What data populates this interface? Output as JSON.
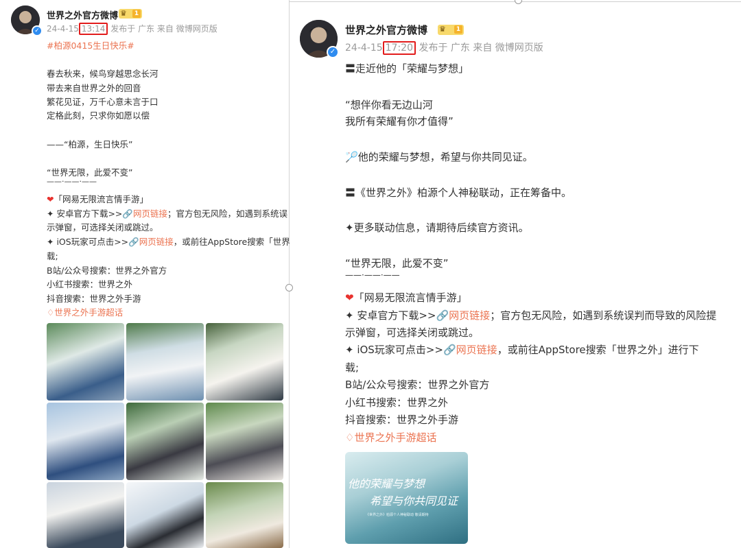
{
  "left_post": {
    "author": "世界之外官方微博",
    "level": "1",
    "date": "24-4-15",
    "time": "13:14",
    "source": "发布于 广东 来自 微博网页版",
    "hashtag": "#柏源0415生日快乐#",
    "poem": [
      "春去秋来，候鸟穿越思念长河",
      "带去来自世界之外的回音",
      "繁花见证，万千心意未言于口",
      "定格此刻，只求你如愿以偿"
    ],
    "wish": "——“柏源，生日快乐”",
    "motto": "“世界无限，此爱不变”",
    "separator": "——·——·——",
    "game_title": "「网易无限流言情手游」",
    "android_prefix": "✦ 安卓官方下载>>",
    "link_text": "网页链接",
    "android_suffix": "；官方包无风险，如遇到系统误",
    "android_cont": "示弹窗，可选择关闭或跳过。",
    "ios_prefix": "✦ iOS玩家可点击>>",
    "ios_suffix": "，或前往AppStore搜索「世界",
    "ios_cont": "载;",
    "bilibili": "B站/公众号搜索：世界之外官方",
    "xiaohongshu": "小红书搜索：世界之外",
    "douyin": "抖音搜索：世界之外手游",
    "super_topic": "世界之外手游超话"
  },
  "right_post": {
    "author": "世界之外官方微博",
    "level": "1",
    "date": "24-4-15",
    "time": "17:20",
    "source": "发布于 广东 来自 微博网页版",
    "intro": "〓走近他的「荣耀与梦想」",
    "quote_1": "“想伴你看无边山河",
    "quote_2": "我所有荣耀有你才值得”",
    "witness": "他的荣耀与梦想，希望与你共同见证。",
    "collab": "〓《世界之外》柏源个人神秘联动，正在筹备中。",
    "more_info": "✦更多联动信息，请期待后续官方资讯。",
    "motto": "“世界无限，此爱不变”",
    "separator": "——·——·——",
    "game_title": "「网易无限流言情手游」",
    "android_prefix": "✦ 安卓官方下载>>",
    "link_text": "网页链接",
    "android_suffix": "；官方包无风险，如遇到系统误判而导致的风险提",
    "android_cont": "示弹窗，可选择关闭或跳过。",
    "ios_prefix": "✦ iOS玩家可点击>>",
    "ios_suffix": "，或前往AppStore搜索「世界之外」进行下",
    "ios_cont": "载;",
    "bilibili": "B站/公众号搜索：世界之外官方",
    "xiaohongshu": "小红书搜索：世界之外",
    "douyin": "抖音搜索：世界之外手游",
    "super_topic": "世界之外手游超话",
    "image_line_1": "他的荣耀与梦想",
    "image_line_2": "希望与你共同见证",
    "image_caption": "《世界之外》柏源个人神秘联动 敬请期待"
  },
  "colors": {
    "link": "#eb7350",
    "highlight_box": "#e21b1b",
    "meta": "#9a9a9a",
    "verified": "#2f8cf0"
  }
}
